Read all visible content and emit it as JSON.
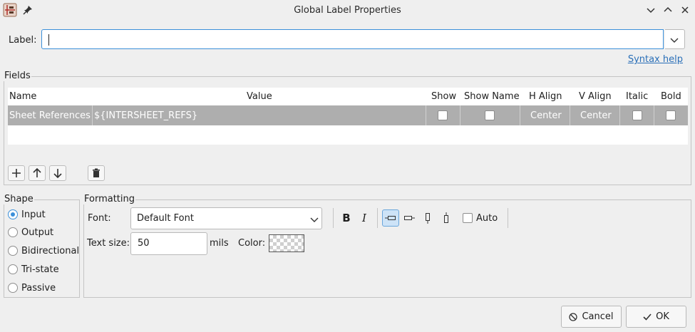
{
  "window": {
    "title": "Global Label Properties"
  },
  "label": {
    "text": "Label:",
    "value": "",
    "syntax_help": "Syntax help"
  },
  "fields": {
    "group_title": "Fields",
    "columns": [
      "Name",
      "Value",
      "Show",
      "Show Name",
      "H Align",
      "V Align",
      "Italic",
      "Bold"
    ],
    "rows": [
      {
        "name": "Sheet References",
        "value": "${INTERSHEET_REFS}",
        "show": false,
        "show_name": false,
        "h_align": "Center",
        "v_align": "Center",
        "italic": false,
        "bold": false
      }
    ]
  },
  "shape": {
    "group_title": "Shape",
    "options": [
      "Input",
      "Output",
      "Bidirectional",
      "Tri-state",
      "Passive"
    ],
    "selected": "Input"
  },
  "formatting": {
    "group_title": "Formatting",
    "font_label": "Font:",
    "font_value": "Default Font",
    "auto_label": "Auto",
    "text_size_label": "Text size:",
    "text_size_value": "50",
    "text_size_unit": "mils",
    "color_label": "Color:"
  },
  "buttons": {
    "cancel": "Cancel",
    "ok": "OK"
  }
}
